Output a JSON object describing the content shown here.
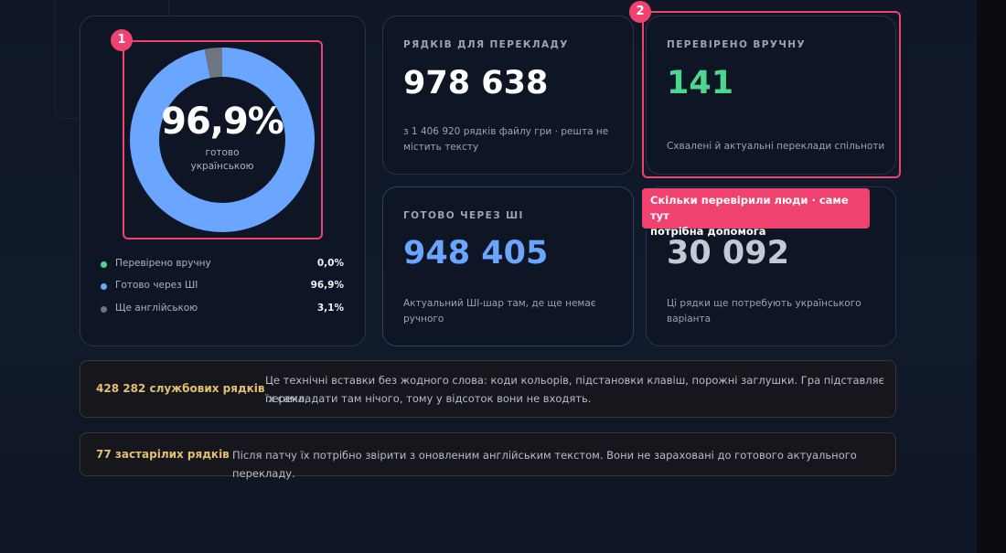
{
  "colors": {
    "manual": "#4cd68e",
    "ai": "#6aa6ff",
    "english": "#6f7682",
    "highlight": "#f0426e",
    "note_title": "#e3bf72"
  },
  "donut": {
    "percent_label": "96,9%",
    "subtitle_line1": "готово",
    "subtitle_line2": "українською",
    "segments": [
      {
        "name": "manual",
        "fraction": 0.0
      },
      {
        "name": "ai",
        "fraction": 0.969
      },
      {
        "name": "english",
        "fraction": 0.031
      }
    ]
  },
  "legend": [
    {
      "label": "Перевірено вручну",
      "value": "0,0%",
      "color": "#4cd68e"
    },
    {
      "label": "Готово через ШІ",
      "value": "96,9%",
      "color": "#6aa6ff"
    },
    {
      "label": "Ще англійською",
      "value": "3,1%",
      "color": "#6f7682"
    }
  ],
  "cards": {
    "total": {
      "label": "РЯДКІВ ДЛЯ ПЕРЕКЛАДУ",
      "value": "978 638",
      "desc_line1": "з 1 406 920 рядків файлу гри · решта не",
      "desc_line2": "містить тексту"
    },
    "manual": {
      "label": "ПЕРЕВІРЕНО ВРУЧНУ",
      "value": "141",
      "desc_line1": "Схвалені й актуальні переклади спільноти"
    },
    "ai": {
      "label": "ГОТОВО ЧЕРЕЗ ШІ",
      "value": "948 405",
      "desc_line1": "Актуальний ШІ-шар там, де ще немає",
      "desc_line2": "ручного"
    },
    "english": {
      "value": "30 092",
      "desc_line1": "Ці рядки ще потребують українського",
      "desc_line2": "варіанта"
    }
  },
  "annotations": {
    "badge1": "1",
    "badge2": "2",
    "tooltip_line1": "Скільки перевірили люди · саме тут",
    "tooltip_line2": "потрібна допомога"
  },
  "notes": {
    "service": {
      "title": "428 282 службових рядків",
      "line1": "Це технічні вставки без жодного слова: коди кольорів, підстановки клавіш, порожні заглушки. Гра підставляє їх сама,",
      "line2": "перекладати там нічого, тому у відсоток вони не входять."
    },
    "outdated": {
      "title": "77 застарілих рядків",
      "line1": "Після патчу їх потрібно звірити з оновленим англійським текстом. Вони не зараховані до готового актуального перекладу."
    }
  }
}
